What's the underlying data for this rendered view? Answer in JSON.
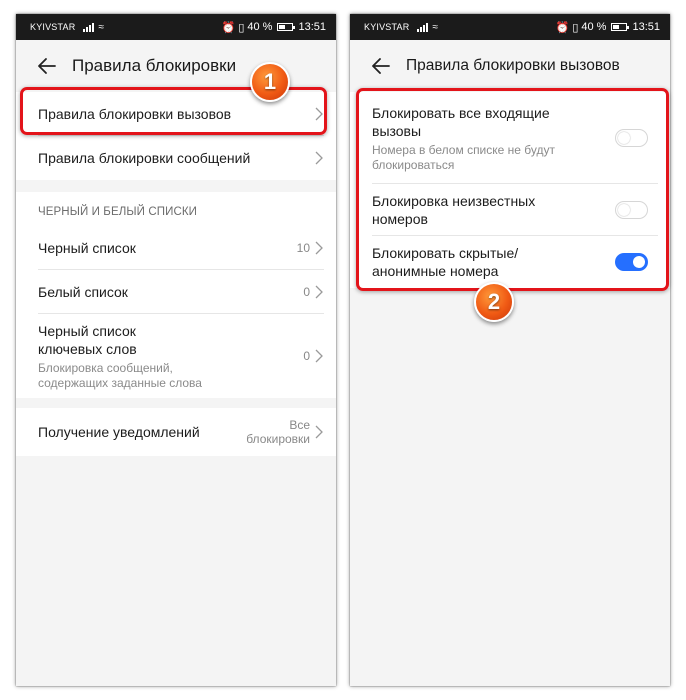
{
  "left_screen": {
    "status": {
      "carrier": "KYIVSTAR",
      "battery": "40 %",
      "time": "13:51"
    },
    "title": "Правила блокировки",
    "rules_items": [
      {
        "label": "Правила блокировки вызовов"
      },
      {
        "label": "Правила блокировки сообщений"
      }
    ],
    "lists_header": "ЧЕРНЫЙ И БЕЛЫЙ СПИСКИ",
    "blacklist": {
      "label": "Черный список",
      "count": "10"
    },
    "whitelist": {
      "label": "Белый список",
      "count": "0"
    },
    "keywords": {
      "label_line1": "Черный список",
      "label_line2": "ключевых слов",
      "sub_line1": "Блокировка сообщений,",
      "sub_line2": "содержащих заданные слова",
      "count": "0"
    },
    "notifications": {
      "label": "Получение уведомлений",
      "value_line1": "Все",
      "value_line2": "блокировки"
    },
    "badge": "1"
  },
  "right_screen": {
    "status": {
      "carrier": "KYIVSTAR",
      "battery": "40 %",
      "time": "13:51"
    },
    "title": "Правила блокировки вызовов",
    "toggles": [
      {
        "label_line1": "Блокировать все входящие",
        "label_line2": "вызовы",
        "sub_line1": "Номера в белом списке не будут",
        "sub_line2": "блокироваться",
        "on": false
      },
      {
        "label_line1": "Блокировка неизвестных",
        "label_line2": "номеров",
        "on": false
      },
      {
        "label_line1": "Блокировать скрытые/",
        "label_line2": "анонимные номера",
        "on": true
      }
    ],
    "badge": "2"
  },
  "colors": {
    "accent": "#256fff",
    "highlight": "#e3141a",
    "badge": "#f05a14"
  }
}
